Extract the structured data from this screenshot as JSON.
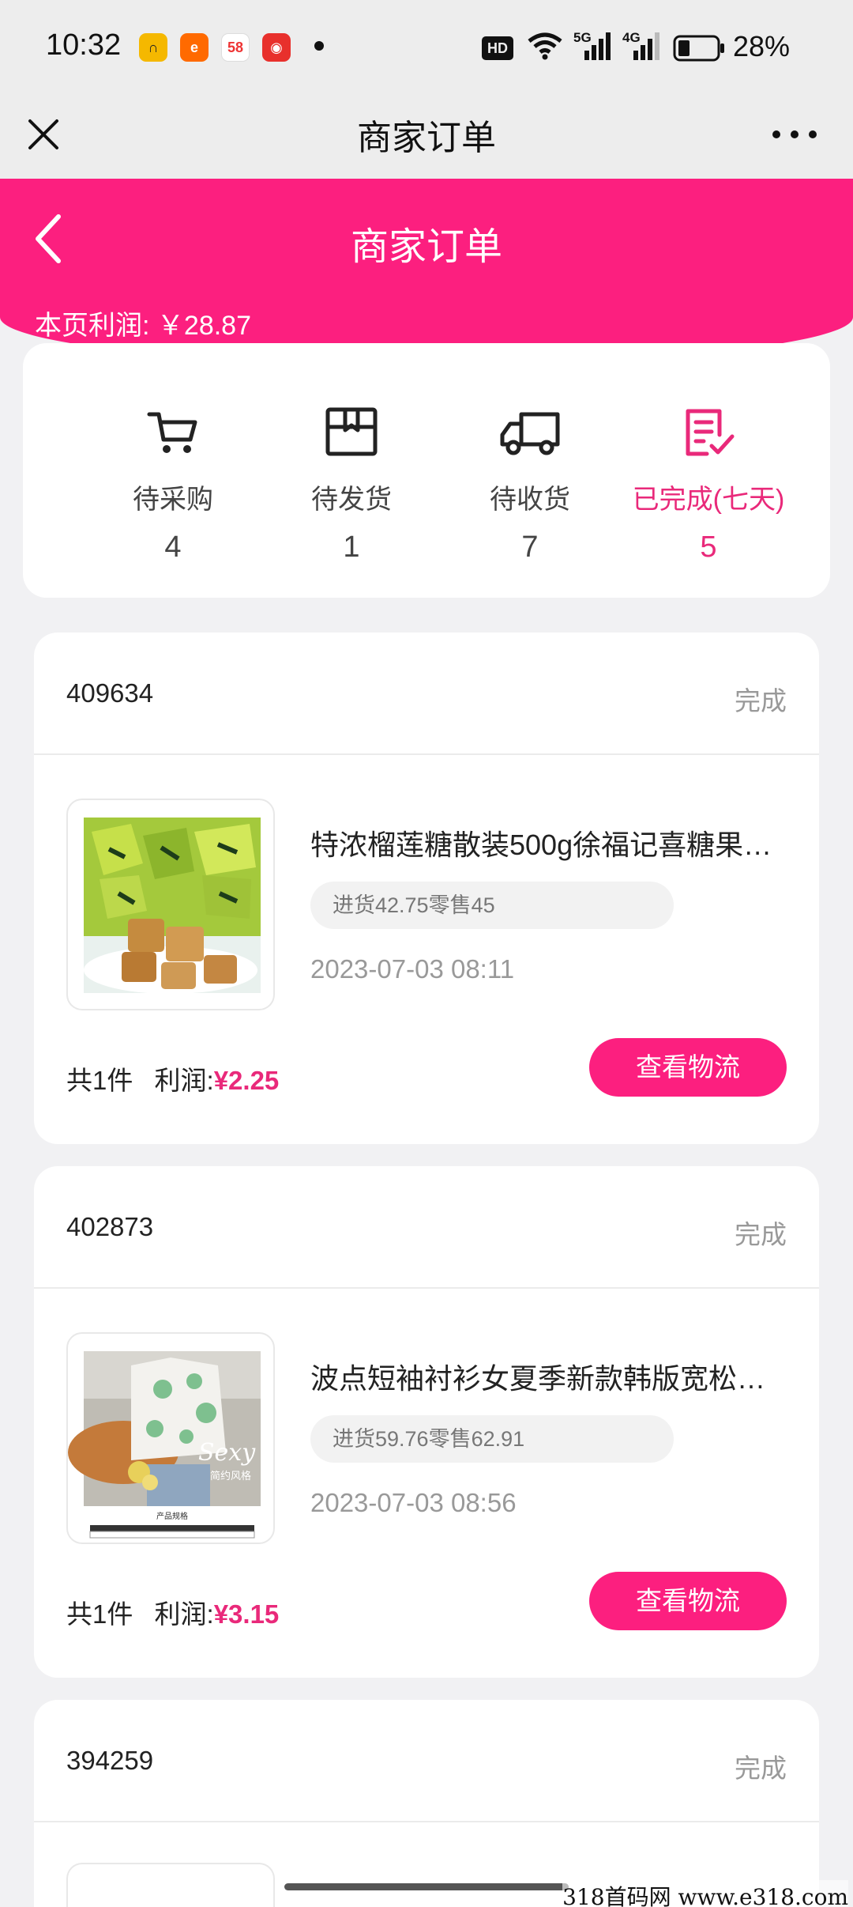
{
  "status_bar": {
    "time": "10:32",
    "hd_label": "HD",
    "network_1": "5G",
    "network_2": "4G",
    "battery": "28%"
  },
  "title_bar": {
    "title": "商家订单"
  },
  "header": {
    "title": "商家订单",
    "page_profit_label": "本页利润:",
    "page_profit_value": "￥28.87"
  },
  "status_tabs": [
    {
      "label": "待采购",
      "count": "4",
      "icon": "shopping-cart-icon"
    },
    {
      "label": "待发货",
      "count": "1",
      "icon": "package-box-icon"
    },
    {
      "label": "待收货",
      "count": "7",
      "icon": "delivery-truck-icon"
    },
    {
      "label": "已完成(七天)",
      "count": "5",
      "icon": "checklist-icon",
      "active": true
    }
  ],
  "orders": [
    {
      "id": "409634",
      "state": "完成",
      "product_name": "特浓榴莲糖散装500g徐福记喜糖果…",
      "price_info": "进货42.75零售45",
      "time": "2023-07-03 08:11",
      "count_text": "共1件",
      "profit_label": "利润:",
      "profit_value": "¥2.25",
      "button": "查看物流"
    },
    {
      "id": "402873",
      "state": "完成",
      "product_name": "波点短袖衬衫女夏季新款韩版宽松…",
      "price_info": "进货59.76零售62.91",
      "time": "2023-07-03 08:56",
      "count_text": "共1件",
      "profit_label": "利润:",
      "profit_value": "¥3.15",
      "button": "查看物流",
      "image_text": {
        "overlay": "Sexy",
        "sub": "简约风格",
        "caption": "产品规格"
      }
    },
    {
      "id": "394259",
      "state": "完成"
    }
  ],
  "watermark": "318首码网  www.e318.com",
  "colors": {
    "accent": "#fc1f7f",
    "active_text": "#e9297a"
  }
}
